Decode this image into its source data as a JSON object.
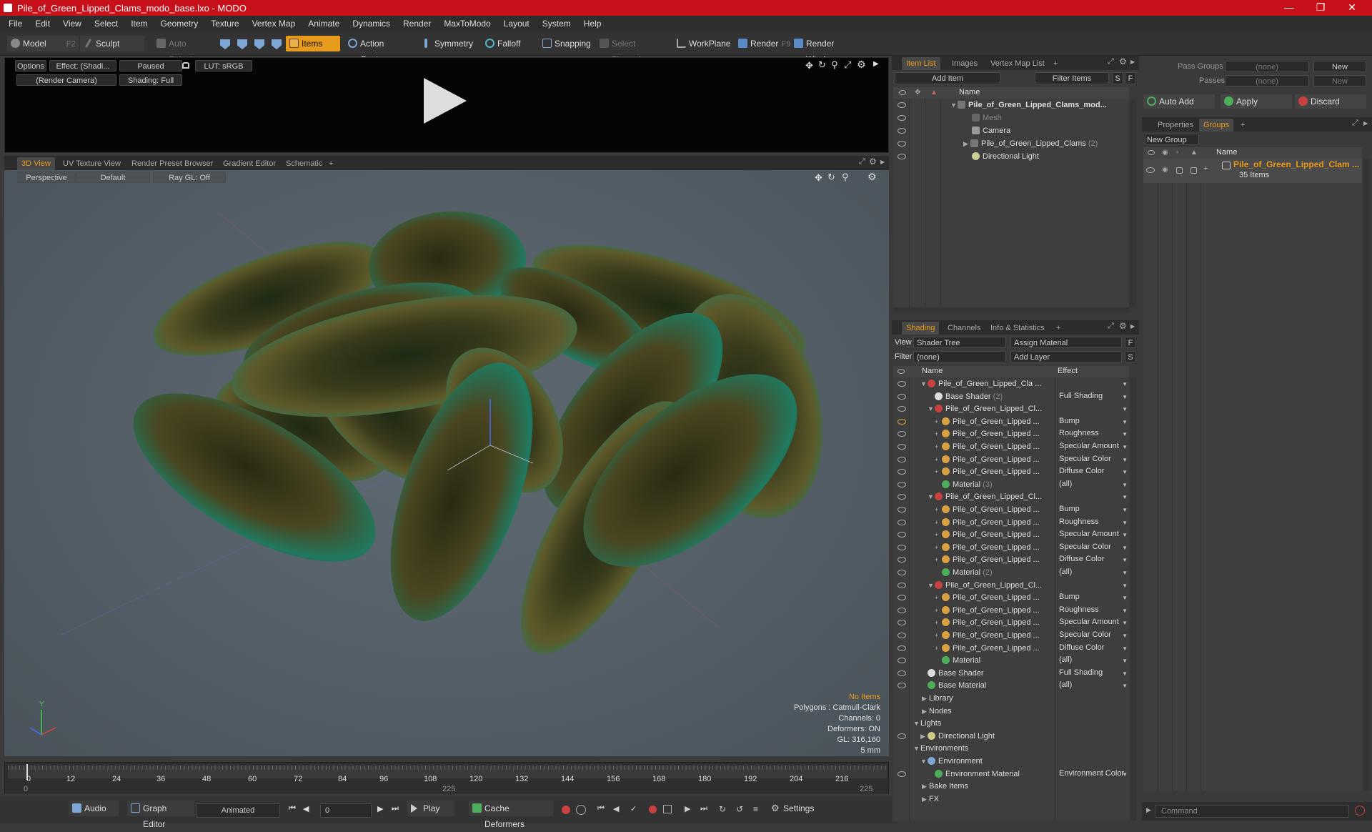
{
  "window": {
    "title": "Pile_of_Green_Lipped_Clams_modo_base.lxo - MODO"
  },
  "menu": [
    "File",
    "Edit",
    "View",
    "Select",
    "Item",
    "Geometry",
    "Texture",
    "Vertex Map",
    "Animate",
    "Dynamics",
    "Render",
    "MaxToModo",
    "Layout",
    "System",
    "Help"
  ],
  "toolbar": {
    "model": "Model",
    "model_key": "F2",
    "sculpt": "Sculpt",
    "auto_select": "Auto Select",
    "items": "Items",
    "action_center": "Action Center",
    "symmetry": "Symmetry",
    "falloff": "Falloff",
    "snapping": "Snapping",
    "select_through": "Select Through",
    "workplane": "WorkPlane",
    "render": "Render",
    "render_key": "F9",
    "render_window": "Render Window"
  },
  "preview": {
    "options": "Options",
    "effect": "Effect: (Shadi...",
    "paused": "Paused",
    "lut": "LUT: sRGB",
    "camera": "(Render Camera)",
    "shading": "Shading: Full"
  },
  "viewport_tabs": [
    "3D View",
    "UV Texture View",
    "Render Preset Browser",
    "Gradient Editor",
    "Schematic",
    "+"
  ],
  "viewport": {
    "perspective": "Perspective",
    "default": "Default",
    "raygl": "Ray GL: Off",
    "stats": {
      "no_items": "No Items",
      "polygons": "Polygons : Catmull-Clark",
      "channels": "Channels: 0",
      "deformers": "Deformers: ON",
      "gl": "GL: 316,160",
      "units": "5 mm"
    }
  },
  "timeline": {
    "ticks": [
      "0",
      "12",
      "24",
      "36",
      "48",
      "60",
      "72",
      "84",
      "96",
      "108",
      "120",
      "132",
      "144",
      "156",
      "168",
      "180",
      "192",
      "204",
      "216"
    ],
    "start": "0",
    "mid": "225",
    "end": "225"
  },
  "bottombar": {
    "audio": "Audio",
    "graph_editor": "Graph Editor",
    "animated": "Animated",
    "frame": "0",
    "play": "Play",
    "cache_deformers": "Cache Deformers",
    "settings": "Settings"
  },
  "item_list": {
    "tabs": [
      "Item List",
      "Images",
      "Vertex Map List",
      "+"
    ],
    "add_item": "Add Item",
    "filter_items": "Filter Items",
    "s": "S",
    "f": "F",
    "col_name": "Name",
    "rows": [
      {
        "label": "Pile_of_Green_Lipped_Clams_mod...",
        "count": ""
      },
      {
        "label": "Mesh",
        "count": ""
      },
      {
        "label": "Camera",
        "count": ""
      },
      {
        "label": "Pile_of_Green_Lipped_Clams",
        "count": "(2)"
      },
      {
        "label": "Directional Light",
        "count": ""
      }
    ]
  },
  "shading": {
    "tabs": [
      "Shading",
      "Channels",
      "Info & Statistics",
      "+"
    ],
    "view_label": "View",
    "view_value": "Shader Tree",
    "assign_material": "Assign Material",
    "filter_label": "Filter",
    "filter_value": "(none)",
    "add_layer": "Add Layer",
    "col_name": "Name",
    "col_effect": "Effect",
    "rows": [
      {
        "label": "Pile_of_Green_Lipped_Cla ...",
        "count": "",
        "effect": ""
      },
      {
        "label": "Base Shader",
        "count": "(2)",
        "effect": "Full Shading"
      },
      {
        "label": "Pile_of_Green_Lipped_Cl...",
        "count": "",
        "effect": ""
      },
      {
        "label": "Pile_of_Green_Lipped ...",
        "count": "",
        "effect": "Bump"
      },
      {
        "label": "Pile_of_Green_Lipped ...",
        "count": "",
        "effect": "Roughness"
      },
      {
        "label": "Pile_of_Green_Lipped ...",
        "count": "",
        "effect": "Specular Amount"
      },
      {
        "label": "Pile_of_Green_Lipped ...",
        "count": "",
        "effect": "Specular Color"
      },
      {
        "label": "Pile_of_Green_Lipped ...",
        "count": "",
        "effect": "Diffuse Color"
      },
      {
        "label": "Material",
        "count": "(3)",
        "effect": "(all)"
      },
      {
        "label": "Pile_of_Green_Lipped_Cl...",
        "count": "",
        "effect": ""
      },
      {
        "label": "Pile_of_Green_Lipped ...",
        "count": "",
        "effect": "Bump"
      },
      {
        "label": "Pile_of_Green_Lipped ...",
        "count": "",
        "effect": "Roughness"
      },
      {
        "label": "Pile_of_Green_Lipped ...",
        "count": "",
        "effect": "Specular Amount"
      },
      {
        "label": "Pile_of_Green_Lipped ...",
        "count": "",
        "effect": "Specular Color"
      },
      {
        "label": "Pile_of_Green_Lipped ...",
        "count": "",
        "effect": "Diffuse Color"
      },
      {
        "label": "Material",
        "count": "(2)",
        "effect": "(all)"
      },
      {
        "label": "Pile_of_Green_Lipped_Cl...",
        "count": "",
        "effect": ""
      },
      {
        "label": "Pile_of_Green_Lipped ...",
        "count": "",
        "effect": "Bump"
      },
      {
        "label": "Pile_of_Green_Lipped ...",
        "count": "",
        "effect": "Roughness"
      },
      {
        "label": "Pile_of_Green_Lipped ...",
        "count": "",
        "effect": "Specular Amount"
      },
      {
        "label": "Pile_of_Green_Lipped ...",
        "count": "",
        "effect": "Specular Color"
      },
      {
        "label": "Pile_of_Green_Lipped ...",
        "count": "",
        "effect": "Diffuse Color"
      },
      {
        "label": "Material",
        "count": "",
        "effect": "(all)"
      },
      {
        "label": "Base Shader",
        "count": "",
        "effect": "Full Shading"
      },
      {
        "label": "Base Material",
        "count": "",
        "effect": "(all)"
      },
      {
        "label": "Library",
        "count": "",
        "effect": ""
      },
      {
        "label": "Nodes",
        "count": "",
        "effect": ""
      },
      {
        "label": "Lights",
        "count": "",
        "effect": ""
      },
      {
        "label": "Directional Light",
        "count": "",
        "effect": ""
      },
      {
        "label": "Environments",
        "count": "",
        "effect": ""
      },
      {
        "label": "Environment",
        "count": "",
        "effect": ""
      },
      {
        "label": "Environment Material",
        "count": "",
        "effect": "Environment Color"
      },
      {
        "label": "Bake Items",
        "count": "",
        "effect": ""
      },
      {
        "label": "FX",
        "count": "",
        "effect": ""
      }
    ]
  },
  "right": {
    "pass_groups": "Pass Groups",
    "passes": "Passes",
    "none": "(none)",
    "new": "New",
    "auto_add": "Auto Add",
    "apply": "Apply",
    "discard": "Discard",
    "tabs": [
      "Properties",
      "Groups",
      "+"
    ],
    "new_group": "New Group",
    "col_name": "Name",
    "group_name": "Pile_of_Green_Lipped_Clam ...",
    "group_items": "35 Items",
    "command": "Command"
  },
  "colors": {
    "accent": "#e89a1c",
    "titlebar": "#c8101a",
    "viewport": "#56616a"
  }
}
